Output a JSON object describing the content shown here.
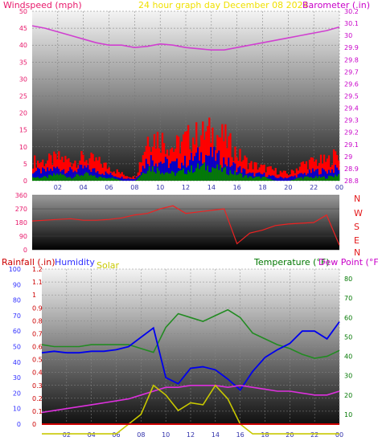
{
  "header": {
    "wind_title": "Windspeed (mph)",
    "graph_title": "24 hour graph day   December 08 2024",
    "baro_title": "Barometer (.in)"
  },
  "bottom_header": {
    "rain": "Rainfall (.in)",
    "humidity": "Humidity",
    "solar": "Solar",
    "temperature": "Temperature (°F)",
    "dewpoint": "Dew Point (°F)"
  },
  "colors": {
    "wind_axis": "#e8176a",
    "baro_axis": "#c800c8",
    "title": "#f0e000",
    "wind_gust": "#ff0000",
    "wind_avg": "#0000cc",
    "wind_low": "#008000",
    "baro_line": "#d040d0",
    "dir_line": "#ee2222",
    "rain_axis": "#cc0000",
    "hum_axis": "#3030ff",
    "solar": "#c8c800",
    "temp_axis": "#007700",
    "dew_axis": "#c800c8",
    "temp_line": "#228B22",
    "hum_line": "#0000ee",
    "dew_line": "#dd30dd",
    "rain_line": "#cc0000"
  },
  "compass": [
    "N",
    "W",
    "S",
    "E",
    "N"
  ],
  "chart_data": [
    {
      "type": "bar",
      "title": "24 hour graph day   December 08 2024",
      "ylabel": "Windspeed (mph)",
      "y2label": "Barometer (.in)",
      "xticks": [
        "02",
        "04",
        "06",
        "08",
        "10",
        "12",
        "14",
        "16",
        "18",
        "20",
        "22",
        "00"
      ],
      "yticks": [
        "0",
        "5",
        "10",
        "15",
        "20",
        "25",
        "30",
        "35",
        "40",
        "45",
        "50"
      ],
      "y2ticks": [
        "28.8",
        "28.9",
        "29",
        "29.1",
        "29.2",
        "29.3",
        "29.4",
        "29.5",
        "29.6",
        "29.7",
        "29.8",
        "29.9",
        "30",
        "30.1",
        "30.2"
      ],
      "ylim": [
        0,
        50
      ],
      "y2lim": [
        28.8,
        30.2
      ],
      "x_hours": [
        0,
        1,
        2,
        3,
        4,
        5,
        6,
        7,
        8,
        9,
        10,
        11,
        12,
        13,
        14,
        15,
        16,
        17,
        18,
        19,
        20,
        21,
        22,
        23,
        24
      ],
      "series": [
        {
          "values": [
            6,
            6,
            7,
            6,
            7,
            6,
            4,
            2,
            1,
            14,
            13,
            10,
            13,
            14,
            15,
            13,
            8,
            5,
            4,
            3,
            2,
            5,
            6,
            6,
            9
          ]
        },
        {
          "values": [
            3,
            3,
            4,
            3,
            4,
            3,
            2,
            1,
            0.5,
            7,
            6,
            5,
            6,
            8,
            8,
            6,
            4,
            2,
            2,
            1,
            1,
            2,
            3,
            3,
            4
          ]
        },
        {
          "values": [
            1,
            1,
            2,
            1,
            2,
            1,
            1,
            0,
            0,
            4,
            3,
            2,
            3,
            4,
            4,
            3,
            2,
            1,
            1,
            0,
            0,
            1,
            1,
            1,
            2
          ]
        },
        {
          "values": [
            30.08,
            30.06,
            30.03,
            30.0,
            29.97,
            29.94,
            29.92,
            29.92,
            29.9,
            29.91,
            29.93,
            29.92,
            29.9,
            29.89,
            29.88,
            29.88,
            29.9,
            29.92,
            29.94,
            29.96,
            29.98,
            30.0,
            30.02,
            30.04,
            30.07
          ]
        }
      ]
    },
    {
      "type": "line",
      "ylabel": "Wind direction",
      "yticks": [
        "0",
        "90",
        "180",
        "270",
        "360"
      ],
      "ylim": [
        0,
        360
      ],
      "x_hours": [
        0,
        1,
        2,
        3,
        4,
        5,
        6,
        7,
        8,
        9,
        10,
        11,
        12,
        13,
        14,
        15,
        16,
        17,
        18,
        19,
        20,
        21,
        22,
        23,
        24
      ],
      "series": [
        {
          "values": [
            190,
            195,
            200,
            205,
            195,
            195,
            200,
            210,
            230,
            240,
            270,
            290,
            240,
            250,
            260,
            270,
            40,
            110,
            130,
            160,
            170,
            175,
            180,
            230,
            30
          ]
        }
      ]
    },
    {
      "type": "line",
      "ylabel": "Rainfall (.in)",
      "y2label": "Temperature (°F)",
      "xticks": [
        "02",
        "04",
        "06",
        "08",
        "10",
        "12",
        "14",
        "16",
        "18",
        "20",
        "22",
        "00"
      ],
      "rain_ticks": [
        "0",
        "0.1",
        "0.2",
        "0.3",
        "0.4",
        "0.5",
        "0.6",
        "0.7",
        "0.8",
        "0.9",
        "1",
        "1.1",
        "1.2"
      ],
      "hum_ticks": [
        "0",
        "10",
        "20",
        "30",
        "40",
        "50",
        "60",
        "70",
        "80",
        "90",
        "100"
      ],
      "temp_ticks": [
        "10",
        "20",
        "30",
        "40",
        "50",
        "60",
        "70",
        "80"
      ],
      "rain_lim": [
        0,
        1.2
      ],
      "hum_lim": [
        0,
        100
      ],
      "temp_lim": [
        5,
        85
      ],
      "x_hours": [
        0,
        1,
        2,
        3,
        4,
        5,
        6,
        7,
        8,
        9,
        10,
        11,
        12,
        13,
        14,
        15,
        16,
        17,
        18,
        19,
        20,
        21,
        22,
        23,
        24
      ],
      "series": [
        {
          "values": [
            46,
            47,
            46,
            46,
            47,
            47,
            48,
            50,
            56,
            62,
            30,
            26,
            36,
            37,
            35,
            29,
            22,
            34,
            43,
            48,
            52,
            60,
            60,
            55,
            66
          ]
        },
        {
          "values": [
            46,
            45,
            45,
            45,
            46,
            46,
            46,
            46,
            44,
            42,
            55,
            62,
            60,
            58,
            61,
            64,
            60,
            52,
            49,
            46,
            44,
            41,
            39,
            40,
            43
          ]
        },
        {
          "values": [
            11,
            12,
            13,
            14,
            15,
            16,
            17,
            18,
            20,
            22,
            24,
            24,
            25,
            25,
            25,
            24,
            25,
            24,
            23,
            22,
            22,
            21,
            20,
            20,
            22
          ]
        },
        {
          "values": [
            0,
            0,
            0,
            0,
            0,
            0,
            0,
            0,
            0,
            0,
            0,
            0,
            0,
            0,
            0,
            0,
            0,
            0,
            0,
            0,
            0,
            0,
            0,
            0,
            0
          ]
        },
        {
          "values": [
            0,
            0,
            0,
            0,
            0,
            0,
            0,
            5,
            10,
            25,
            20,
            12,
            16,
            15,
            25,
            18,
            5,
            0,
            0,
            0,
            0,
            0,
            0,
            0,
            0
          ]
        }
      ]
    }
  ]
}
